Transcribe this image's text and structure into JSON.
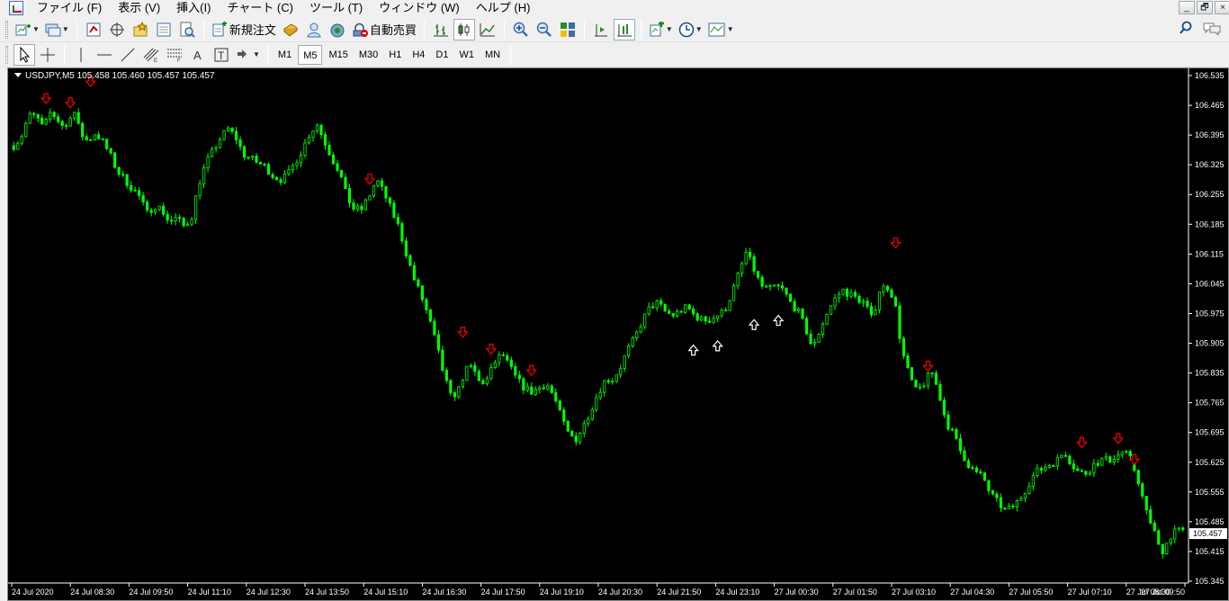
{
  "menu": [
    "ファイル (F)",
    "表示 (V)",
    "挿入(I)",
    "チャート (C)",
    "ツール (T)",
    "ウィンドウ (W)",
    "ヘルプ (H)"
  ],
  "window_controls": [
    "_",
    "🗗",
    "×"
  ],
  "toolbar": {
    "new_order_label": "新規注文",
    "auto_trading_label": "自動売買"
  },
  "timeframes": [
    "M1",
    "M5",
    "M15",
    "M30",
    "H1",
    "H4",
    "D1",
    "W1",
    "MN"
  ],
  "active_timeframe": "M5",
  "chart": {
    "symbol_line": "USDJPY,M5  105.458 105.460 105.457 105.457",
    "current_price_label": "105.457",
    "colors": {
      "background": "#000000",
      "candles": "#00ff00",
      "sell_arrow": "#ff0000",
      "buy_arrow": "#ffffff",
      "price_box": "#ffffff"
    }
  },
  "chart_data": {
    "type": "line",
    "series": [
      {
        "values": [
          106.37,
          106.39,
          106.44,
          106.44,
          106.41,
          106.45,
          106.43,
          106.41,
          106.46,
          106.4,
          106.38,
          106.4,
          106.38,
          106.35,
          106.31,
          106.29,
          106.27,
          106.25,
          106.21,
          106.23,
          106.22,
          106.19,
          106.2,
          106.18,
          106.2,
          106.28,
          106.33,
          106.36,
          106.39,
          106.41,
          106.39,
          106.35,
          106.34,
          106.33,
          106.32,
          106.3,
          106.29,
          106.3,
          106.33,
          106.36,
          106.4,
          106.42,
          106.38,
          106.34,
          106.31,
          106.25,
          106.22,
          106.22,
          106.25,
          106.29,
          106.26,
          106.22,
          106.18,
          106.12,
          106.06,
          106.02,
          105.97,
          105.91,
          105.84,
          105.78,
          105.79,
          105.84,
          105.85,
          105.81,
          105.82,
          105.86,
          105.88,
          105.85,
          105.82,
          105.8,
          105.79,
          105.8,
          105.81,
          105.78,
          105.73,
          105.69,
          105.68,
          105.71,
          105.75,
          105.79,
          105.82,
          105.82,
          105.85,
          105.89,
          105.92,
          105.96,
          105.99,
          106.0,
          105.98,
          105.97,
          105.98,
          105.99,
          105.97,
          105.96,
          105.96,
          105.97,
          105.98,
          106.02,
          106.07,
          106.12,
          106.08,
          106.04,
          106.03,
          106.04,
          106.03,
          106.0,
          105.98,
          105.94,
          105.89,
          105.94,
          105.98,
          106.01,
          106.03,
          106.02,
          106.01,
          106.0,
          105.96,
          106.03,
          106.04,
          106.01,
          105.89,
          105.83,
          105.79,
          105.81,
          105.84,
          105.79,
          105.72,
          105.69,
          105.65,
          105.62,
          105.6,
          105.59,
          105.55,
          105.53,
          105.51,
          105.52,
          105.54,
          105.57,
          105.6,
          105.61,
          105.62,
          105.63,
          105.65,
          105.62,
          105.6,
          105.6,
          105.62,
          105.63,
          105.63,
          105.64,
          105.65,
          105.63,
          105.58,
          105.51,
          105.47,
          105.41,
          105.44,
          105.47,
          105.46
        ]
      }
    ],
    "x_tick_labels": [
      "24 Jul 2020",
      "24 Jul 08:30",
      "24 Jul 09:50",
      "24 Jul 11:10",
      "24 Jul 12:30",
      "24 Jul 13:50",
      "24 Jul 15:10",
      "24 Jul 16:30",
      "24 Jul 17:50",
      "24 Jul 19:10",
      "24 Jul 20:30",
      "24 Jul 21:50",
      "24 Jul 23:10",
      "27 Jul 00:30",
      "27 Jul 01:50",
      "27 Jul 03:10",
      "27 Jul 04:30",
      "27 Jul 05:50",
      "27 Jul 07:10",
      "27 Jul 08:30",
      "27 Jul 09:50"
    ],
    "y_tick_labels": [
      "106.535",
      "106.465",
      "106.395",
      "106.325",
      "106.255",
      "106.185",
      "106.115",
      "106.045",
      "105.975",
      "105.905",
      "105.835",
      "105.765",
      "105.695",
      "105.625",
      "105.555",
      "105.485",
      "105.415",
      "105.345"
    ],
    "ylim": [
      105.345,
      106.535
    ],
    "current_price": 105.457,
    "sell_signals": [
      {
        "index": 8,
        "price": 106.48
      },
      {
        "index": 14,
        "price": 106.47
      },
      {
        "index": 19,
        "price": 106.52
      },
      {
        "index": 88,
        "price": 106.29
      },
      {
        "index": 111,
        "price": 105.93
      },
      {
        "index": 118,
        "price": 105.89
      },
      {
        "index": 128,
        "price": 105.84
      },
      {
        "index": 218,
        "price": 106.14
      },
      {
        "index": 226,
        "price": 105.85
      },
      {
        "index": 264,
        "price": 105.67
      },
      {
        "index": 273,
        "price": 105.68
      },
      {
        "index": 277,
        "price": 105.63
      }
    ],
    "buy_signals": [
      {
        "index": 168,
        "price": 105.89
      },
      {
        "index": 174,
        "price": 105.9
      },
      {
        "index": 183,
        "price": 105.95
      },
      {
        "index": 189,
        "price": 105.96
      }
    ],
    "bar_count": 290
  }
}
